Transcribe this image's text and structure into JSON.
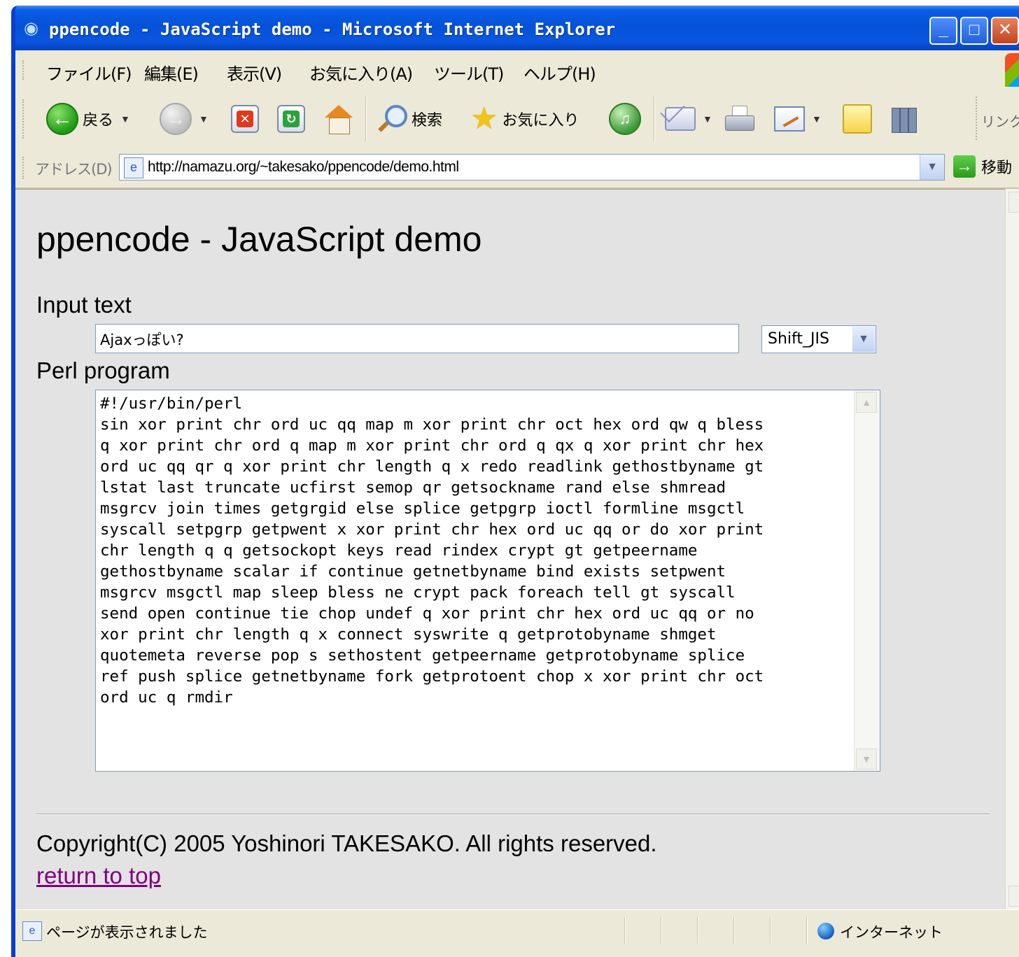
{
  "window": {
    "title": "ppencode - JavaScript demo - Microsoft Internet Explorer"
  },
  "menu": {
    "items": [
      "ファイル(F)",
      "編集(E)",
      "表示(V)",
      "お気に入り(A)",
      "ツール(T)",
      "ヘルプ(H)"
    ]
  },
  "toolbar": {
    "back_label": "戻る",
    "search_label": "検索",
    "favorites_label": "お気に入り",
    "links_label": "リンク"
  },
  "address": {
    "label": "アドレス(D)",
    "url": "http://namazu.org/~takesako/ppencode/demo.html",
    "go_label": "移動"
  },
  "page": {
    "title": "ppencode - JavaScript demo",
    "input_heading": "Input text",
    "input_value": "Ajaxっぽい?",
    "encoding_selected": "Shift_JIS",
    "perl_heading": "Perl program",
    "perl_code": "#!/usr/bin/perl\nsin xor print chr ord uc qq map m xor print chr oct hex ord qw q bless\nq xor print chr ord q map m xor print chr ord q qx q xor print chr hex\nord uc qq qr q xor print chr length q x redo readlink gethostbyname gt\nlstat last truncate ucfirst semop qr getsockname rand else shmread\nmsgrcv join times getgrgid else splice getpgrp ioctl formline msgctl\nsyscall setpgrp getpwent x xor print chr hex ord uc qq or do xor print\nchr length q q getsockopt keys read rindex crypt gt getpeername\ngethostbyname scalar if continue getnetbyname bind exists setpwent\nmsgrcv msgctl map sleep bless ne crypt pack foreach tell gt syscall\nsend open continue tie chop undef q xor print chr hex ord uc qq or no\nxor print chr length q x connect syswrite q getprotobyname shmget\nquotemeta reverse pop s sethostent getpeername getprotobyname splice\nref push splice getnetbyname fork getprotoent chop x xor print chr oct\nord uc q rmdir",
    "copyright": "Copyright(C) 2005 Yoshinori TAKESAKO. All rights reserved.",
    "return_link": "return to top"
  },
  "status": {
    "text": "ページが表示されました",
    "zone": "インターネット"
  },
  "colors": {
    "titlebar": "#0452d8",
    "content_bg": "#e3e3e3",
    "visited_link": "#800080"
  }
}
